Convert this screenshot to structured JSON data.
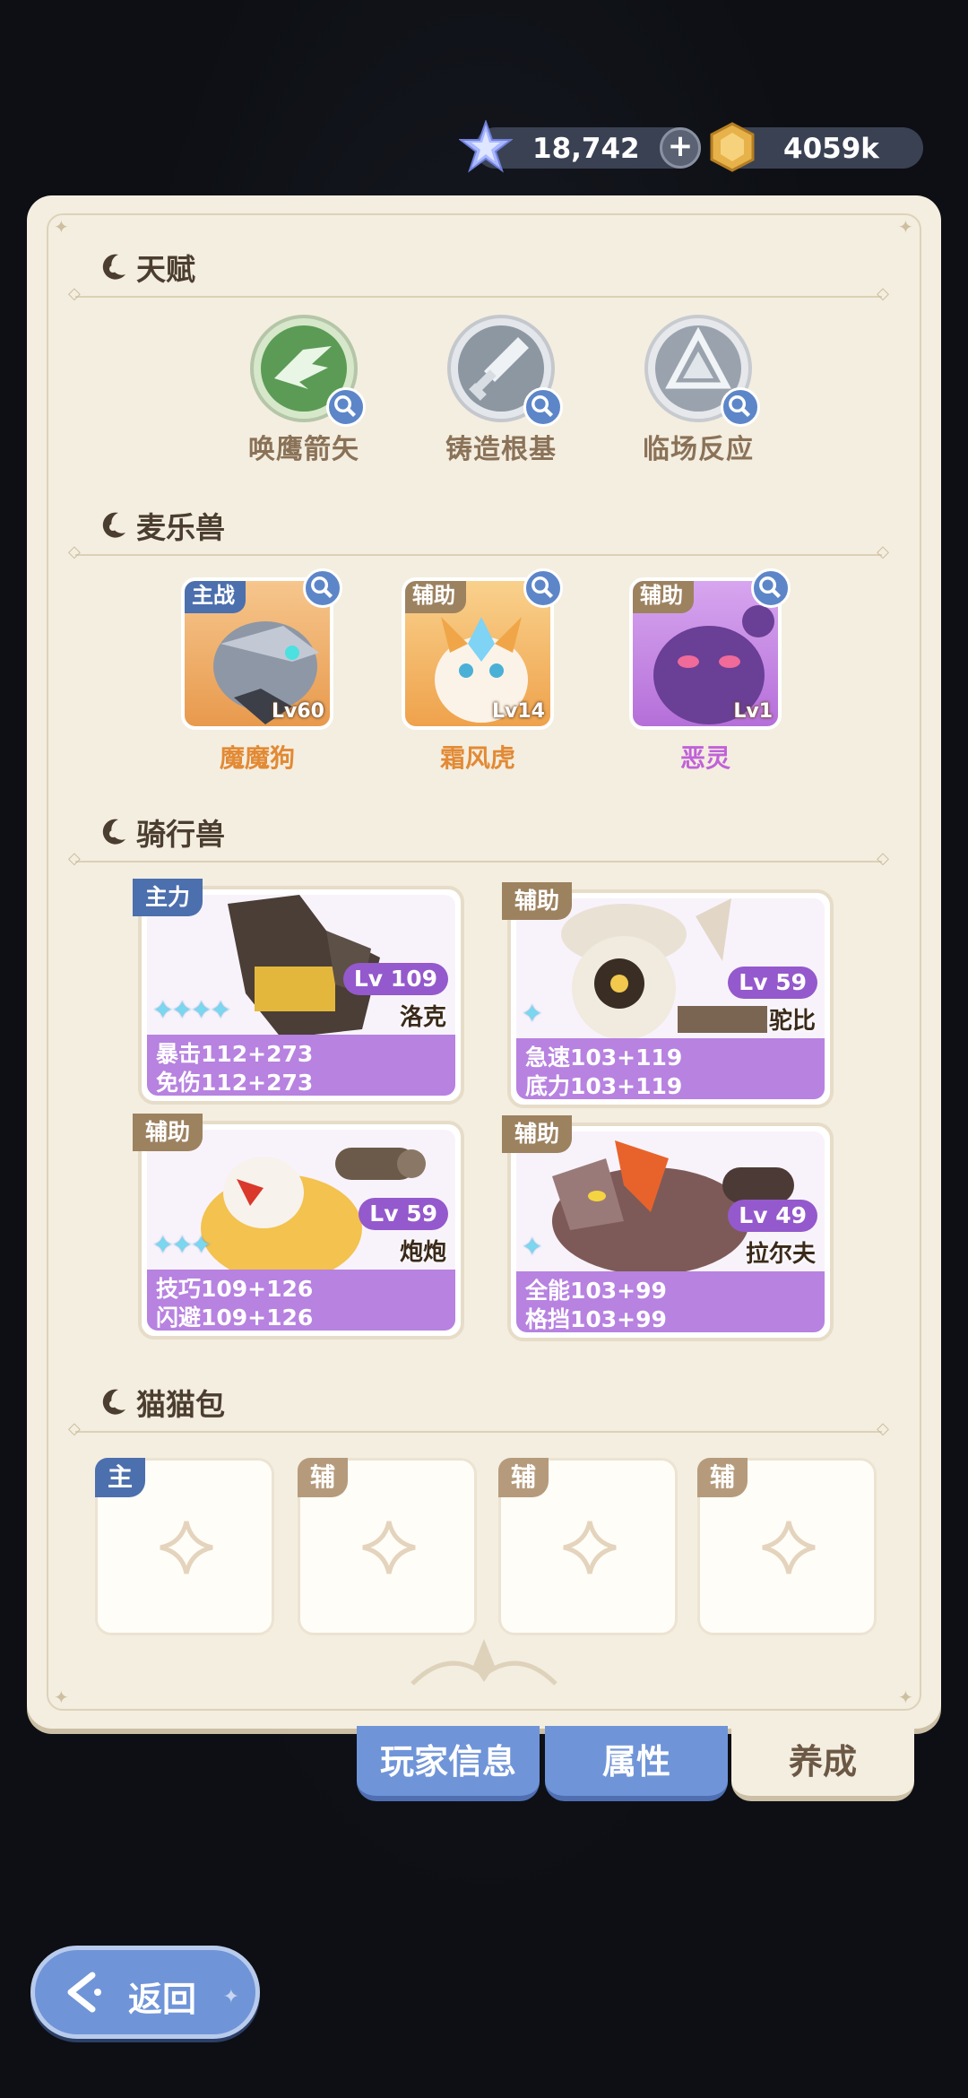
{
  "currency": {
    "gems": "18,742",
    "gold": "4059k"
  },
  "sections": {
    "talent": "天赋",
    "pets": "麦乐兽",
    "mounts": "骑行兽",
    "bags": "猫猫包"
  },
  "talents": [
    {
      "label": "唤鹰箭矢",
      "icon": "eagle-emblem-icon",
      "color": "#5b9b56"
    },
    {
      "label": "铸造根基",
      "icon": "sword-emblem-icon",
      "color": "#8c97a2"
    },
    {
      "label": "临场反应",
      "icon": "crystal-emblem-icon",
      "color": "#9aa3ad"
    }
  ],
  "pets": [
    {
      "role": "主战",
      "name": "魔魔狗",
      "level": "Lv60",
      "name_color": "#e28a35"
    },
    {
      "role": "辅助",
      "name": "霜风虎",
      "level": "Lv14",
      "name_color": "#e28a35"
    },
    {
      "role": "辅助",
      "name": "恶灵",
      "level": "Lv1",
      "name_color": "#c062d8"
    }
  ],
  "mounts": [
    {
      "role": "主力",
      "level": "Lv 109",
      "name": "洛克",
      "stars": "✦✦✦✦",
      "stat1": "暴击112+273",
      "stat2": "免伤112+273"
    },
    {
      "role": "辅助",
      "level": "Lv 59",
      "name": "驼比",
      "stars": "✦",
      "stat1": "急速103+119",
      "stat2": "底力103+119"
    },
    {
      "role": "辅助",
      "level": "Lv 59",
      "name": "炮炮",
      "stars": "✦✦✦",
      "stat1": "技巧109+126",
      "stat2": "闪避109+126"
    },
    {
      "role": "辅助",
      "level": "Lv 49",
      "name": "拉尔夫",
      "stars": "✦",
      "stat1": "全能103+99",
      "stat2": "格挡103+99"
    }
  ],
  "bags": [
    {
      "role": "主"
    },
    {
      "role": "辅"
    },
    {
      "role": "辅"
    },
    {
      "role": "辅"
    }
  ],
  "tabs": {
    "player_info": "玩家信息",
    "attributes": "属性",
    "cultivate": "养成"
  },
  "back_label": "返回",
  "colors": {
    "accent_blue": "#6f94d8",
    "panel": "#f4eee0",
    "mount_purple": "#b782e0"
  }
}
